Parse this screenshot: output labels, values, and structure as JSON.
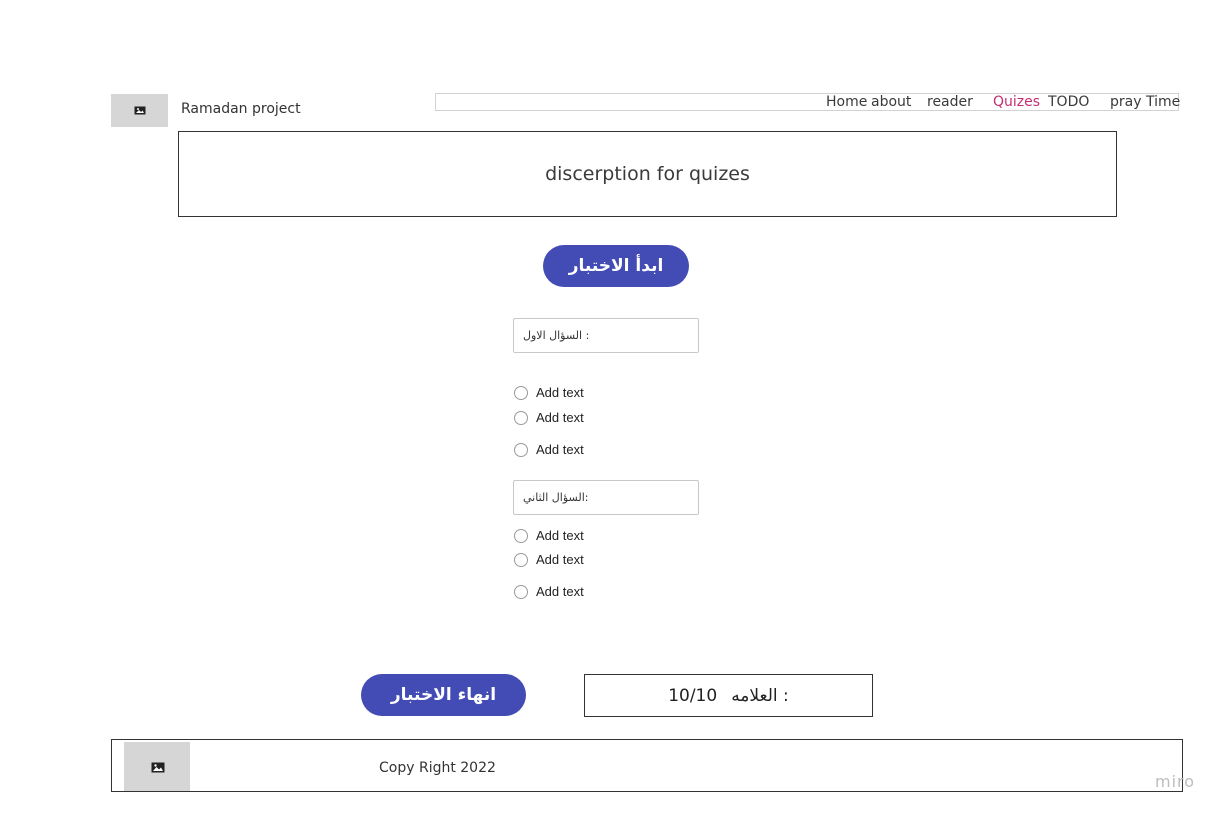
{
  "header": {
    "logo_icon": "image-icon",
    "title": "Ramadan project",
    "nav": [
      {
        "label": "Home",
        "active": false
      },
      {
        "label": "about",
        "active": false
      },
      {
        "label": "reader",
        "active": false
      },
      {
        "label": "Quizes",
        "active": true
      },
      {
        "label": "TODO",
        "active": false
      },
      {
        "label": "pray Time",
        "active": false
      }
    ]
  },
  "description": "discerption for quizes",
  "start_button": "ابدأ الاختبار",
  "questions": [
    {
      "label": ": السؤال الاول",
      "options": [
        "Add text",
        "Add text",
        "Add text"
      ]
    },
    {
      "label": ":السؤال الثاني",
      "options": [
        "Add text",
        "Add text",
        "Add text"
      ]
    }
  ],
  "end_button": "انهاء الاختبار",
  "score": {
    "label": "العلامه :",
    "value": "10/10"
  },
  "footer": {
    "logo_icon": "image-icon",
    "copyright": "Copy Right 2022"
  },
  "watermark": "miro",
  "colors": {
    "accent": "#434bb5",
    "active_nav": "#c2306f"
  }
}
